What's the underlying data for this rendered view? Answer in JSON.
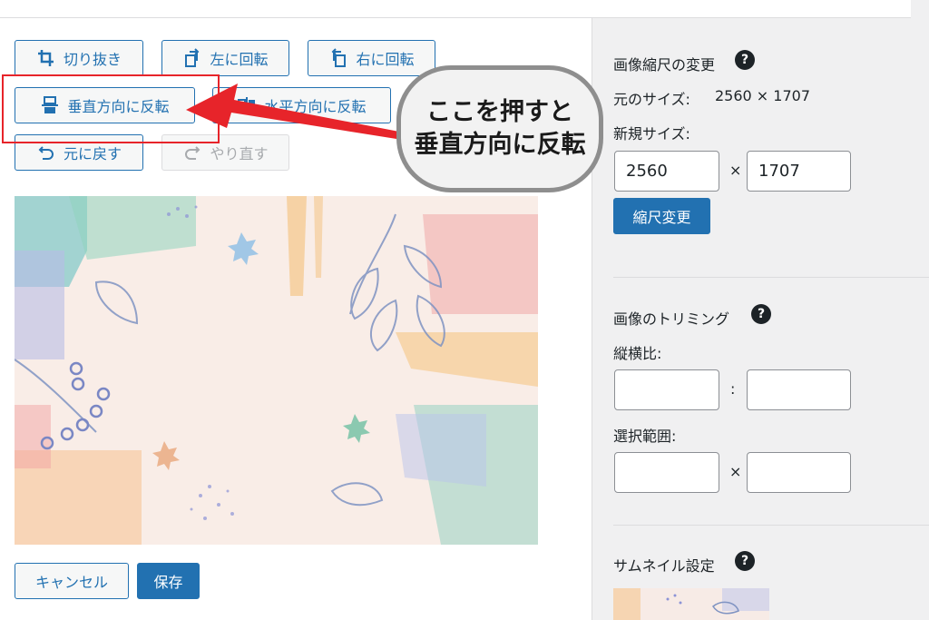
{
  "toolbar": {
    "crop": "切り抜き",
    "rotate_left": "左に回転",
    "rotate_right": "右に回転",
    "flip_vertical": "垂直方向に反転",
    "flip_horizontal": "水平方向に反転",
    "undo": "元に戻す",
    "redo": "やり直す"
  },
  "footer": {
    "cancel": "キャンセル",
    "save": "保存"
  },
  "scale": {
    "title": "画像縮尺の変更",
    "original_size_label": "元のサイズ:",
    "original_size_value": "2560 × 1707",
    "new_size_label": "新規サイズ:",
    "width": "2560",
    "height": "1707",
    "times": "×",
    "button": "縮尺変更"
  },
  "crop_panel": {
    "title": "画像のトリミング",
    "aspect_label": "縦横比:",
    "aspect_sep": ":",
    "selection_label": "選択範囲:",
    "selection_sep": "×"
  },
  "thumbnail": {
    "title": "サムネイル設定"
  },
  "help_glyph": "?",
  "annotation": {
    "line1": "ここを押すと",
    "line2": "垂直方向に反転"
  },
  "colors": {
    "accent": "#2271b1",
    "annotation_red": "#e7242a",
    "sidebar_bg": "#f0f0f1"
  },
  "icons": [
    "crop-icon",
    "rotate-left-icon",
    "rotate-right-icon",
    "flip-vertical-icon",
    "flip-horizontal-icon",
    "undo-icon",
    "redo-icon",
    "help-icon"
  ]
}
